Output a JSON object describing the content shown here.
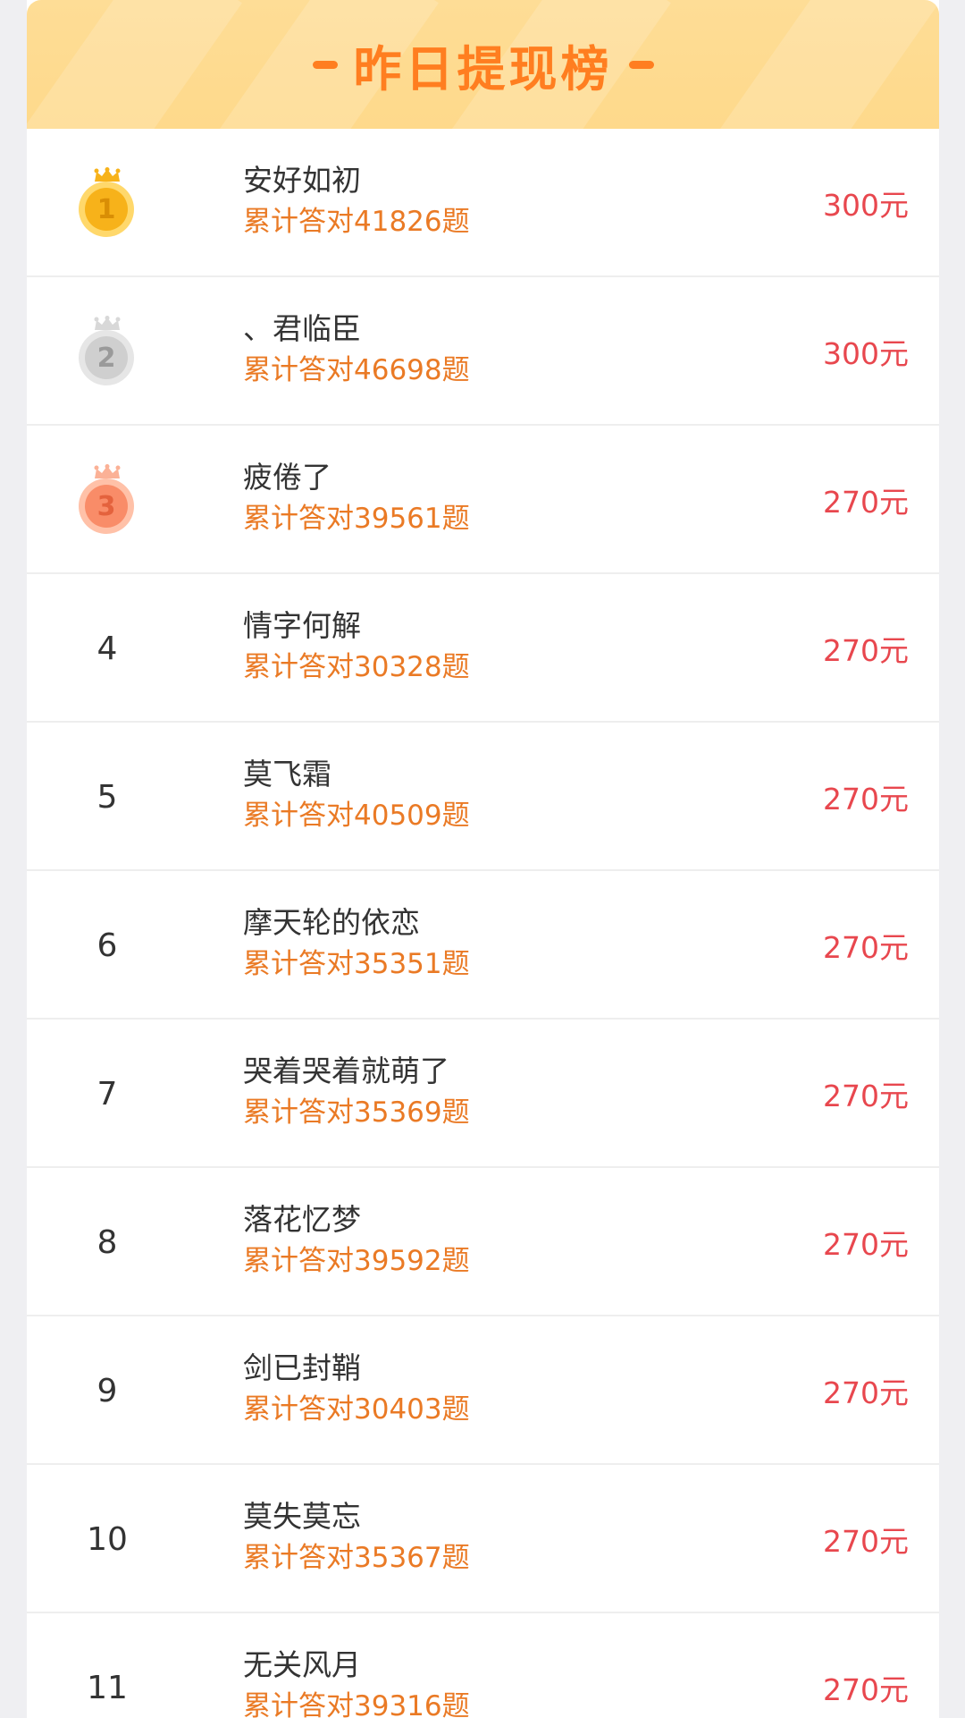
{
  "header": {
    "title": "昨日提现榜",
    "accent_color": "#ff7e20",
    "background_color": "#fed98b"
  },
  "colors": {
    "name": "#333333",
    "subtitle": "#ea7a25",
    "amount": "#e8474e",
    "gold": "#f7b21a",
    "silver": "#cfcfcf",
    "bronze": "#f98c68"
  },
  "leaderboard": [
    {
      "rank": "1",
      "medal": "gold",
      "name": "安好如初",
      "subtitle": "累计答对41826题",
      "amount": "300元"
    },
    {
      "rank": "2",
      "medal": "silver",
      "name": "、君临臣",
      "subtitle": "累计答对46698题",
      "amount": "300元"
    },
    {
      "rank": "3",
      "medal": "bronze",
      "name": "疲倦了",
      "subtitle": "累计答对39561题",
      "amount": "270元"
    },
    {
      "rank": "4",
      "medal": "",
      "name": "情字何解",
      "subtitle": "累计答对30328题",
      "amount": "270元"
    },
    {
      "rank": "5",
      "medal": "",
      "name": "莫飞霜",
      "subtitle": "累计答对40509题",
      "amount": "270元"
    },
    {
      "rank": "6",
      "medal": "",
      "name": "摩天轮的依恋",
      "subtitle": "累计答对35351题",
      "amount": "270元"
    },
    {
      "rank": "7",
      "medal": "",
      "name": "哭着哭着就萌了",
      "subtitle": "累计答对35369题",
      "amount": "270元"
    },
    {
      "rank": "8",
      "medal": "",
      "name": "落花忆梦",
      "subtitle": "累计答对39592题",
      "amount": "270元"
    },
    {
      "rank": "9",
      "medal": "",
      "name": "剑已封鞘",
      "subtitle": "累计答对30403题",
      "amount": "270元"
    },
    {
      "rank": "10",
      "medal": "",
      "name": "莫失莫忘",
      "subtitle": "累计答对35367题",
      "amount": "270元"
    },
    {
      "rank": "11",
      "medal": "",
      "name": "无关风月",
      "subtitle": "累计答对39316题",
      "amount": "270元"
    }
  ]
}
